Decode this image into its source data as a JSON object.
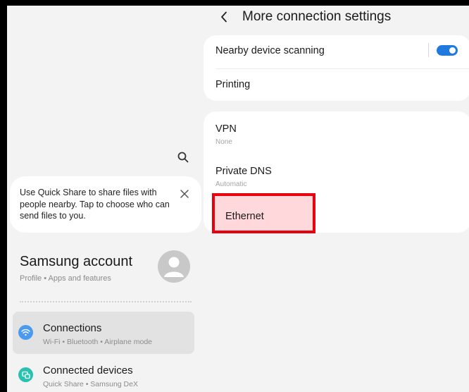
{
  "left_pane": {
    "quick_share_tip": "Use Quick Share to share files with people nearby. Tap to choose who can send files to you.",
    "account": {
      "title": "Samsung account",
      "subtitle": "Profile • Apps and features"
    },
    "menu": [
      {
        "title": "Connections",
        "subtitle": "Wi-Fi • Bluetooth • Airplane mode",
        "icon": "wifi-icon",
        "selected": true
      },
      {
        "title": "Connected devices",
        "subtitle": "Quick Share • Samsung DeX",
        "icon": "connected-devices-icon",
        "selected": false
      }
    ]
  },
  "right_pane": {
    "title": "More connection settings",
    "group1": [
      {
        "title": "Nearby device scanning",
        "toggle_on": true
      },
      {
        "title": "Printing"
      }
    ],
    "group2": [
      {
        "title": "VPN",
        "subtitle": "None"
      },
      {
        "title": "Private DNS",
        "subtitle": "Automatic"
      },
      {
        "title": "Ethernet",
        "highlighted": true
      }
    ]
  },
  "colors": {
    "accent": "#1f7ae0",
    "highlight_border": "#e8000e",
    "connections_icon": "#4a9af0",
    "devices_icon": "#28c2b0",
    "background": "#f3f3f3"
  },
  "icons": [
    "search-icon",
    "close-icon",
    "person-icon",
    "wifi-icon",
    "connected-devices-icon",
    "back-arrow-icon"
  ]
}
